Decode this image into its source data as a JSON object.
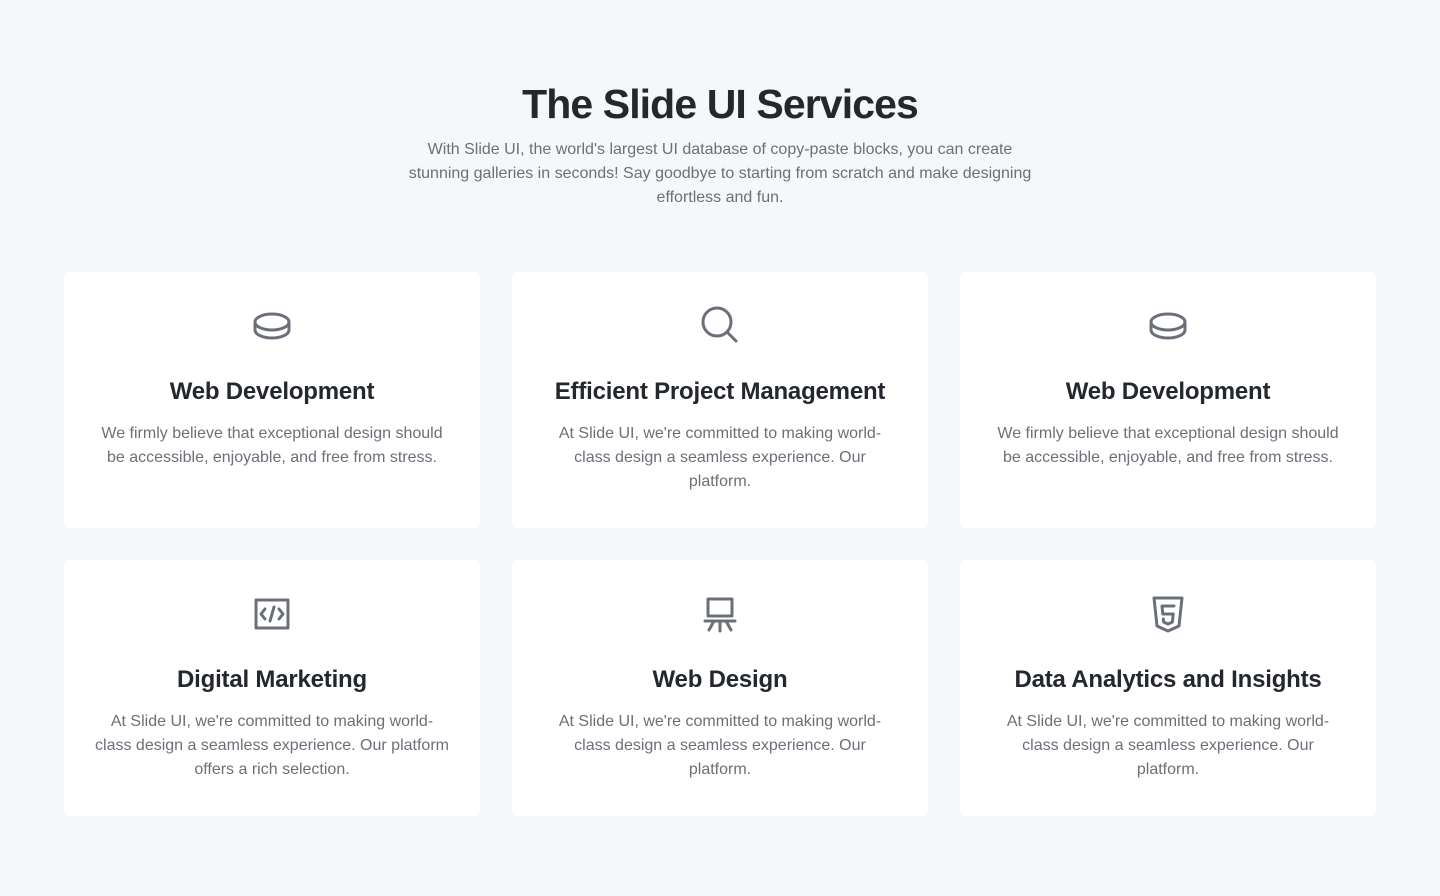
{
  "header": {
    "title": "The Slide UI Services",
    "subtitle": "With Slide UI, the world's largest UI database of copy-paste blocks, you can create stunning galleries in seconds! Say goodbye to starting from scratch and make designing effortless and fun."
  },
  "colors": {
    "background": "#f6f7f9",
    "card": "#ffffff",
    "heading": "#24282d",
    "body_text": "#6b7078",
    "icon": "#6b7078"
  },
  "cards": [
    {
      "icon": "coin-stack-icon",
      "title": "Web Development",
      "text": "We firmly believe that exceptional design should be accessible, enjoyable, and free from stress."
    },
    {
      "icon": "search-icon",
      "title": "Efficient Project Management",
      "text": "At Slide UI, we're committed to making world-class design a seamless experience. Our platform."
    },
    {
      "icon": "coin-stack-icon",
      "title": "Web Development",
      "text": "We firmly believe that exceptional design should be accessible, enjoyable, and free from stress."
    },
    {
      "icon": "code-icon",
      "title": "Digital Marketing",
      "text": "At Slide UI, we're committed to making world-class design a seamless experience. Our platform offers a rich selection."
    },
    {
      "icon": "presentation-icon",
      "title": "Web Design",
      "text": "At Slide UI, we're committed to making world-class design a seamless experience. Our platform."
    },
    {
      "icon": "html5-icon",
      "title": "Data Analytics and Insights",
      "text": "At Slide UI, we're committed to making world-class design a seamless experience. Our platform."
    }
  ]
}
